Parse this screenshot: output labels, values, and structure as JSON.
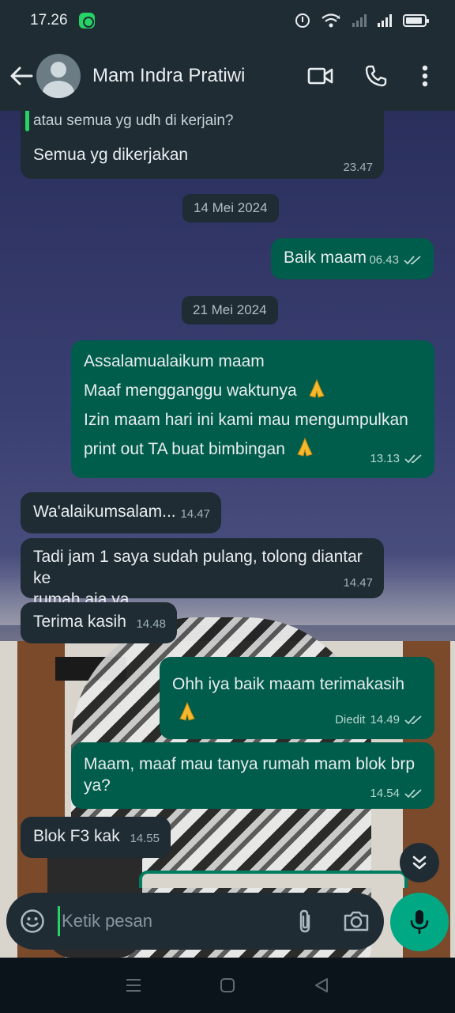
{
  "status_bar": {
    "time": "17.26",
    "battery_level": 0.9
  },
  "header": {
    "contact_name": "Mam Indra Pratiwi",
    "icons": [
      "back-arrow-icon",
      "video-call-icon",
      "voice-call-icon",
      "more-options-icon"
    ]
  },
  "messages": {
    "quoted_text": "atau semua yg udh di kerjain?",
    "m0_text": "Semua yg dikerjakan",
    "m0_time": "23.47",
    "date1": "14 Mei 2024",
    "m1_text": "Baik maam",
    "m1_time": "06.43",
    "date2": "21 Mei 2024",
    "m2_line1": "Assalamualaikum maam",
    "m2_line2": "Maaf mengganggu waktunya",
    "m2_line3": "Izin maam hari ini kami mau mengumpulkan",
    "m2_line4": "print out TA buat bimbingan",
    "m2_time": "13.13",
    "m3_text": "Wa'alaikumsalam...",
    "m3_time": "14.47",
    "m4_line1": "Tadi jam 1 saya sudah pulang, tolong diantar ke",
    "m4_line2": "rumah aja ya",
    "m4_time": "14.47",
    "m5_text": "Terima kasih",
    "m5_time": "14.48",
    "m6_text": "Ohh iya baik maam terimakasih",
    "m6_edited": "Diedit",
    "m6_time": "14.49",
    "m7_line1": "Maam, maaf mau tanya rumah mam blok brp",
    "m7_line2": "ya?",
    "m7_time": "14.54",
    "m8_text": "Blok F3 kak",
    "m8_time": "14.55"
  },
  "input": {
    "placeholder": "Ketik pesan"
  },
  "colors": {
    "incoming_bubble": "#1f2c34",
    "outgoing_bubble": "#005c4b",
    "accent": "#00a884",
    "read_ticks": "#9fb1ba"
  }
}
